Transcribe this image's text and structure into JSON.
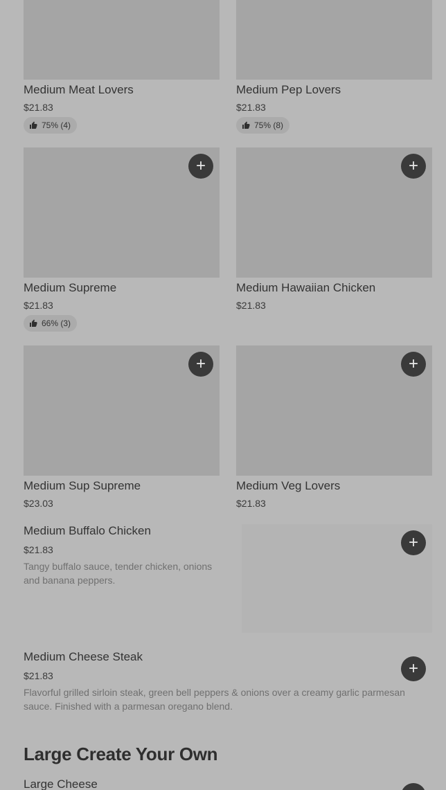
{
  "grid_items": [
    {
      "name": "Medium Meat Lovers",
      "price": "$21.83",
      "rating": "75% (4)"
    },
    {
      "name": "Medium Pep Lovers",
      "price": "$21.83",
      "rating": "75% (8)"
    },
    {
      "name": "Medium Supreme",
      "price": "$21.83",
      "rating": "66% (3)"
    },
    {
      "name": "Medium Hawaiian Chicken",
      "price": "$21.83"
    },
    {
      "name": "Medium Sup Supreme",
      "price": "$23.03"
    },
    {
      "name": "Medium Veg Lovers",
      "price": "$21.83"
    }
  ],
  "list_items": [
    {
      "name": "Medium Buffalo Chicken",
      "price": "$21.83",
      "description": "Tangy buffalo sauce, tender chicken, onions and banana peppers."
    },
    {
      "name": "Medium Cheese Steak",
      "price": "$21.83",
      "description": "Flavorful grilled sirloin steak, green bell peppers & onions over a creamy garlic parmesan sauce. Finished with a parmesan oregano blend."
    }
  ],
  "section": {
    "title": "Large Create Your Own"
  },
  "next_item": {
    "name": "Large Cheese"
  },
  "icons": {
    "add": "plus-icon",
    "rating": "thumbs-up-icon"
  },
  "add_symbol": "+"
}
